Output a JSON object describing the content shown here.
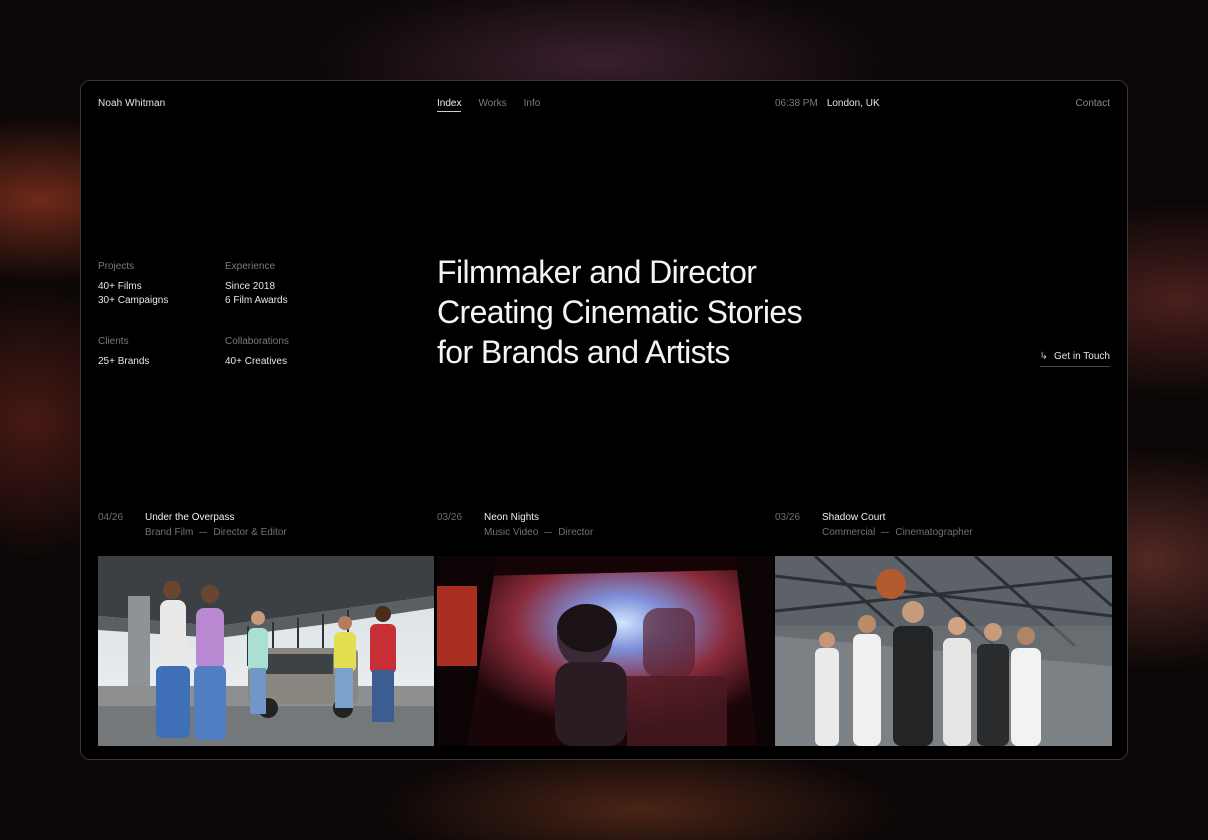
{
  "header": {
    "brand": "Noah Whitman",
    "nav": [
      "Index",
      "Works",
      "Info"
    ],
    "time": "06:38 PM",
    "location": "London, UK",
    "contact": "Contact"
  },
  "stats": [
    {
      "label": "Projects",
      "lines": [
        "40+ Films",
        "30+ Campaigns"
      ]
    },
    {
      "label": "Experience",
      "lines": [
        "Since 2018",
        "6 Film Awards"
      ]
    },
    {
      "label": "Clients",
      "lines": [
        "25+ Brands"
      ]
    },
    {
      "label": "Collaborations",
      "lines": [
        "40+ Creatives"
      ]
    }
  ],
  "hero": {
    "lines": [
      "Filmmaker and Director",
      "Creating Cinematic Stories",
      "for Brands and Artists"
    ],
    "cta": "Get in Touch"
  },
  "works": [
    {
      "date": "04/26",
      "title": "Under the Overpass",
      "category": "Brand Film",
      "role": "Director & Editor"
    },
    {
      "date": "03/26",
      "title": "Neon Nights",
      "category": "Music Video",
      "role": "Director"
    },
    {
      "date": "03/26",
      "title": "Shadow Court",
      "category": "Commercial",
      "role": "Cinematographer"
    }
  ],
  "colors": {
    "frame_bg": "#000000",
    "text_primary": "#f0f0f0",
    "text_muted": "#7a7a7a",
    "accent_red": "#c2402e"
  }
}
